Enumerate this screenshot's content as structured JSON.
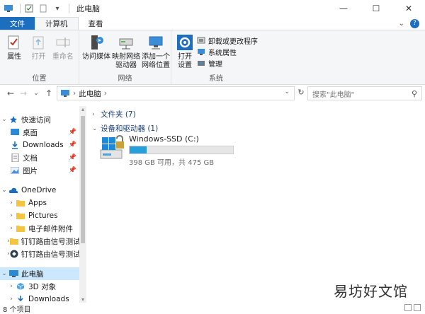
{
  "window": {
    "title": "此电脑",
    "controls": {
      "minimize": "—",
      "maximize": "☐",
      "close": "✕"
    }
  },
  "tabs": [
    {
      "label": "文件"
    },
    {
      "label": "计算机"
    },
    {
      "label": "查看"
    }
  ],
  "ribbon": {
    "groups": [
      {
        "label": "位置",
        "buttons": [
          {
            "label": "属性",
            "icon": "properties-icon",
            "disabled": false
          },
          {
            "label": "打开",
            "icon": "open-icon",
            "disabled": true
          },
          {
            "label": "重命名",
            "icon": "rename-icon",
            "disabled": true
          }
        ]
      },
      {
        "label": "网络",
        "buttons": [
          {
            "label": "访问媒体",
            "icon": "media-icon"
          },
          {
            "label": "映射网络\n驱动器",
            "icon": "map-drive-icon"
          },
          {
            "label": "添加一个\n网络位置",
            "icon": "network-location-icon"
          }
        ]
      },
      {
        "label": "系统",
        "big_button": {
          "label": "打开\n设置",
          "icon": "settings-icon"
        },
        "small_buttons": [
          {
            "label": "卸载或更改程序",
            "icon": "uninstall-icon"
          },
          {
            "label": "系统属性",
            "icon": "system-properties-icon"
          },
          {
            "label": "管理",
            "icon": "manage-icon"
          }
        ]
      }
    ]
  },
  "address": {
    "path": "此电脑",
    "separator": "›",
    "search_placeholder": "搜索\"此电脑\""
  },
  "nav_pane": {
    "items": [
      {
        "label": "快速访问",
        "level": 0,
        "expanded": true,
        "icon": "star-icon",
        "pinned": false
      },
      {
        "label": "桌面",
        "level": 1,
        "icon": "desktop-icon",
        "pinned": true
      },
      {
        "label": "Downloads",
        "level": 1,
        "icon": "downloads-icon",
        "pinned": true
      },
      {
        "label": "文档",
        "level": 1,
        "icon": "documents-icon",
        "pinned": true
      },
      {
        "label": "图片",
        "level": 1,
        "icon": "pictures-icon",
        "pinned": true
      },
      {
        "label": "OneDrive",
        "level": 0,
        "expanded": true,
        "icon": "onedrive-icon",
        "pinned": false
      },
      {
        "label": "Apps",
        "level": 1,
        "icon": "folder-icon",
        "expandable": true
      },
      {
        "label": "Pictures",
        "level": 1,
        "icon": "folder-icon",
        "expandable": true
      },
      {
        "label": "电子邮件附件",
        "level": 1,
        "icon": "folder-icon",
        "expandable": true
      },
      {
        "label": "钉钉路由信号测试",
        "level": 1,
        "icon": "folder-icon",
        "expandable": true
      },
      {
        "label": "钉钉路由信号测试",
        "level": 1,
        "icon": "dingtalk-icon",
        "expandable": true
      },
      {
        "label": "此电脑",
        "level": 0,
        "expanded": true,
        "icon": "pc-icon",
        "selected": true
      },
      {
        "label": "3D 对象",
        "level": 1,
        "icon": "3d-objects-icon",
        "expandable": true
      },
      {
        "label": "Downloads",
        "level": 1,
        "icon": "downloads-icon",
        "expandable": true
      }
    ]
  },
  "content": {
    "folders_header": "文件夹 (7)",
    "devices_header": "设备和驱动器 (1)",
    "drive": {
      "name": "Windows-SSD (C:)",
      "free": "398 GB 可用，共 475 GB",
      "used_fraction": 0.162
    }
  },
  "status": {
    "item_count": "8 个项目"
  },
  "watermark": "易坊好文馆",
  "colors": {
    "accent": "#1e6ec0",
    "selection": "#cce8ff",
    "drive_bar": "#26a0da"
  }
}
